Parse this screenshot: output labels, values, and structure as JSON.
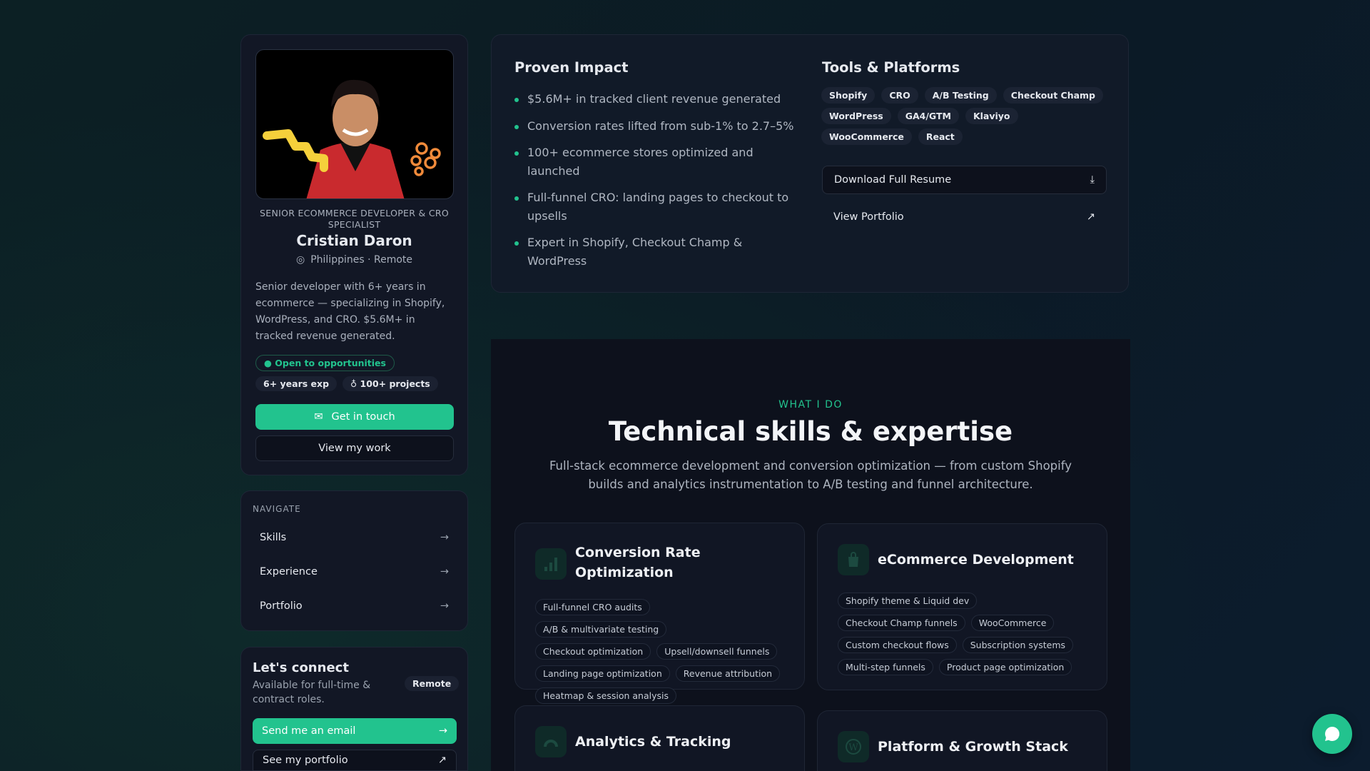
{
  "profile": {
    "role": "SENIOR ECOMMERCE DEVELOPER & CRO SPECIALIST",
    "name": "Cristian Daron",
    "location": "Philippines · Remote",
    "bio": "Senior developer with 6+ years in ecommerce — specializing in Shopify, WordPress, and CRO. $5.6M+ in tracked revenue generated.",
    "status": "Open to opportunities",
    "exp": "6+ years exp",
    "projects": "100+ projects",
    "cta": "Get in touch",
    "secondary": "View my work"
  },
  "nav": {
    "label": "NAVIGATE",
    "items": [
      {
        "label": "Skills"
      },
      {
        "label": "Experience"
      },
      {
        "label": "Portfolio"
      }
    ],
    "arrow": "→"
  },
  "connect": {
    "title": "Let's connect",
    "subtitle": "Available for full-time & contract roles.",
    "badge": "Remote",
    "email": "Send me an email",
    "portfolio": "See my portfolio"
  },
  "impact": {
    "title": "Proven Impact",
    "items": [
      "$5.6M+ in tracked client revenue generated",
      "Conversion rates lifted from sub-1% to 2.7–5%",
      "100+ ecommerce stores optimized and launched",
      "Full-funnel CRO: landing pages to checkout to upsells",
      "Expert in Shopify, Checkout Champ & WordPress"
    ]
  },
  "tools": {
    "title": "Tools & Platforms",
    "tags": [
      "Shopify",
      "CRO",
      "A/B Testing",
      "Checkout Champ",
      "WordPress",
      "GA4/GTM",
      "Klaviyo",
      "WooCommerce",
      "React"
    ],
    "download": "Download Full Resume",
    "portfolio": "View Portfolio"
  },
  "skills": {
    "eyebrow": "WHAT I DO",
    "title": "Technical skills & expertise",
    "description": "Full-stack ecommerce development and conversion optimization — from custom Shopify builds and analytics instrumentation to A/B testing and funnel architecture.",
    "cards": [
      {
        "title": "Conversion Rate Optimization",
        "icon": "bar-chart-icon",
        "chips": [
          "Full-funnel CRO audits",
          "A/B & multivariate testing",
          "Checkout optimization",
          "Upsell/downsell funnels",
          "Landing page optimization",
          "Revenue attribution",
          "Heatmap & session analysis"
        ]
      },
      {
        "title": "eCommerce Development",
        "icon": "shopify-bag-icon",
        "chips": [
          "Shopify theme & Liquid dev",
          "Checkout Champ funnels",
          "WooCommerce",
          "Custom checkout flows",
          "Subscription systems",
          "Multi-step funnels",
          "Product page optimization"
        ]
      },
      {
        "title": "Analytics & Tracking",
        "icon": "gauge-icon"
      },
      {
        "title": "Platform & Growth Stack",
        "icon": "wordpress-icon"
      }
    ]
  },
  "colors": {
    "accent": "#22c38e",
    "card": "#121725"
  }
}
